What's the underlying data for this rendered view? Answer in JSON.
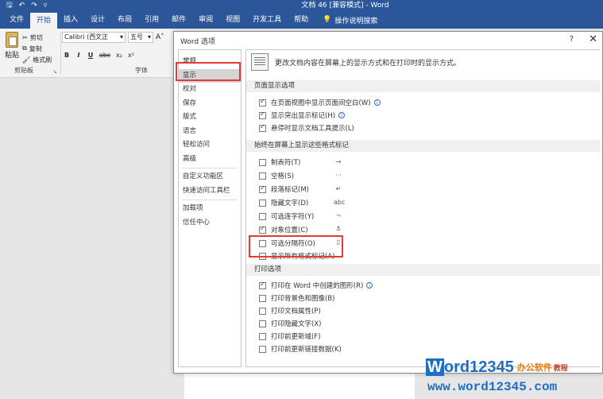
{
  "titlebar": {
    "title": "文档 46 [兼容模式] - Word",
    "qat_icons": [
      "save-icon",
      "undo-icon",
      "redo-icon",
      "customize-qat-icon"
    ]
  },
  "ribbon_tabs": [
    "文件",
    "开始",
    "插入",
    "设计",
    "布局",
    "引用",
    "邮件",
    "审阅",
    "视图",
    "开发工具",
    "帮助"
  ],
  "active_tab": "开始",
  "tell_me": "操作说明搜索",
  "clipboard": {
    "paste": "粘贴",
    "cut": "剪切",
    "copy": "复制",
    "format_painter": "格式刷",
    "group_label": "剪贴板"
  },
  "font": {
    "name": "Calibri (西文正",
    "size": "五号",
    "group_label": "字体",
    "buttons": [
      "B",
      "I",
      "U",
      "abc",
      "x₂",
      "x²"
    ]
  },
  "dialog": {
    "title": "Word 选项",
    "help": "?",
    "close": "✕",
    "nav": [
      "常规",
      "显示",
      "校对",
      "保存",
      "版式",
      "语言",
      "轻松访问",
      "高级",
      "自定义功能区",
      "快速访问工具栏",
      "加载项",
      "信任中心"
    ],
    "selected_nav": "显示",
    "intro": "更改文档内容在屏幕上的显示方式和在打印时的显示方式。",
    "page_display": {
      "header": "页面显示选项",
      "options": [
        {
          "label": "在页面视图中显示页面间空白(W)",
          "checked": true,
          "info": true
        },
        {
          "label": "显示突出显示标记(H)",
          "checked": true,
          "info": true
        },
        {
          "label": "悬停时显示文档工具提示(L)",
          "checked": true,
          "info": false
        }
      ]
    },
    "formatting_marks": {
      "header": "始终在屏幕上显示这些格式标记",
      "options": [
        {
          "label": "制表符(T)",
          "checked": false,
          "symbol": "→"
        },
        {
          "label": "空格(S)",
          "checked": false,
          "symbol": "···"
        },
        {
          "label": "段落标记(M)",
          "checked": true,
          "symbol": "↵"
        },
        {
          "label": "隐藏文字(D)",
          "checked": false,
          "symbol": "abc"
        },
        {
          "label": "可选连字符(Y)",
          "checked": false,
          "symbol": "¬"
        },
        {
          "label": "对象位置(C)",
          "checked": true,
          "symbol": "⚓"
        },
        {
          "label": "可选分隔符(O)",
          "checked": false,
          "symbol": "▯"
        },
        {
          "label": "显示所有格式标记(A)",
          "checked": false,
          "symbol": ""
        }
      ]
    },
    "print_options": {
      "header": "打印选项",
      "options": [
        {
          "label": "打印在 Word 中创建的图形(R)",
          "checked": true,
          "info": true
        },
        {
          "label": "打印背景色和图像(B)",
          "checked": false,
          "info": false
        },
        {
          "label": "打印文档属性(P)",
          "checked": false,
          "info": false
        },
        {
          "label": "打印隐藏文字(X)",
          "checked": false,
          "info": false
        },
        {
          "label": "打印前更新域(F)",
          "checked": false,
          "info": false
        },
        {
          "label": "打印前更新链接数据(K)",
          "checked": false,
          "info": false
        }
      ]
    }
  },
  "watermark": {
    "w": "W",
    "rest": "ord12345",
    "cn1": "办公软件",
    "cn2": "教程",
    "url": "www.word12345.com"
  },
  "colors": {
    "ribbon_blue": "#2b579a",
    "highlight_red": "#e53935",
    "watermark_blue": "#1f6dc7"
  }
}
